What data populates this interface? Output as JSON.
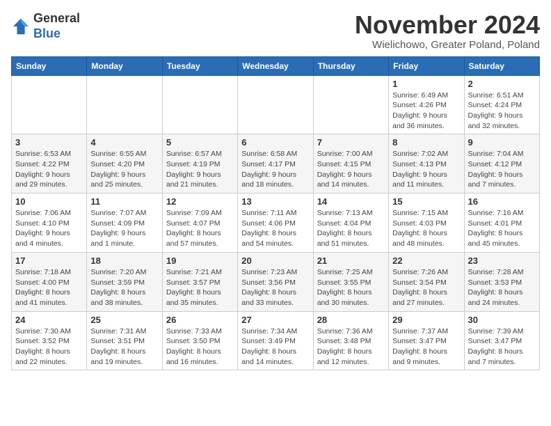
{
  "logo": {
    "general": "General",
    "blue": "Blue"
  },
  "title": "November 2024",
  "location": "Wielichowo, Greater Poland, Poland",
  "weekdays": [
    "Sunday",
    "Monday",
    "Tuesday",
    "Wednesday",
    "Thursday",
    "Friday",
    "Saturday"
  ],
  "weeks": [
    [
      {
        "day": "",
        "info": ""
      },
      {
        "day": "",
        "info": ""
      },
      {
        "day": "",
        "info": ""
      },
      {
        "day": "",
        "info": ""
      },
      {
        "day": "",
        "info": ""
      },
      {
        "day": "1",
        "info": "Sunrise: 6:49 AM\nSunset: 4:26 PM\nDaylight: 9 hours and 36 minutes."
      },
      {
        "day": "2",
        "info": "Sunrise: 6:51 AM\nSunset: 4:24 PM\nDaylight: 9 hours and 32 minutes."
      }
    ],
    [
      {
        "day": "3",
        "info": "Sunrise: 6:53 AM\nSunset: 4:22 PM\nDaylight: 9 hours and 29 minutes."
      },
      {
        "day": "4",
        "info": "Sunrise: 6:55 AM\nSunset: 4:20 PM\nDaylight: 9 hours and 25 minutes."
      },
      {
        "day": "5",
        "info": "Sunrise: 6:57 AM\nSunset: 4:19 PM\nDaylight: 9 hours and 21 minutes."
      },
      {
        "day": "6",
        "info": "Sunrise: 6:58 AM\nSunset: 4:17 PM\nDaylight: 9 hours and 18 minutes."
      },
      {
        "day": "7",
        "info": "Sunrise: 7:00 AM\nSunset: 4:15 PM\nDaylight: 9 hours and 14 minutes."
      },
      {
        "day": "8",
        "info": "Sunrise: 7:02 AM\nSunset: 4:13 PM\nDaylight: 9 hours and 11 minutes."
      },
      {
        "day": "9",
        "info": "Sunrise: 7:04 AM\nSunset: 4:12 PM\nDaylight: 9 hours and 7 minutes."
      }
    ],
    [
      {
        "day": "10",
        "info": "Sunrise: 7:06 AM\nSunset: 4:10 PM\nDaylight: 9 hours and 4 minutes."
      },
      {
        "day": "11",
        "info": "Sunrise: 7:07 AM\nSunset: 4:09 PM\nDaylight: 9 hours and 1 minute."
      },
      {
        "day": "12",
        "info": "Sunrise: 7:09 AM\nSunset: 4:07 PM\nDaylight: 8 hours and 57 minutes."
      },
      {
        "day": "13",
        "info": "Sunrise: 7:11 AM\nSunset: 4:06 PM\nDaylight: 8 hours and 54 minutes."
      },
      {
        "day": "14",
        "info": "Sunrise: 7:13 AM\nSunset: 4:04 PM\nDaylight: 8 hours and 51 minutes."
      },
      {
        "day": "15",
        "info": "Sunrise: 7:15 AM\nSunset: 4:03 PM\nDaylight: 8 hours and 48 minutes."
      },
      {
        "day": "16",
        "info": "Sunrise: 7:16 AM\nSunset: 4:01 PM\nDaylight: 8 hours and 45 minutes."
      }
    ],
    [
      {
        "day": "17",
        "info": "Sunrise: 7:18 AM\nSunset: 4:00 PM\nDaylight: 8 hours and 41 minutes."
      },
      {
        "day": "18",
        "info": "Sunrise: 7:20 AM\nSunset: 3:59 PM\nDaylight: 8 hours and 38 minutes."
      },
      {
        "day": "19",
        "info": "Sunrise: 7:21 AM\nSunset: 3:57 PM\nDaylight: 8 hours and 35 minutes."
      },
      {
        "day": "20",
        "info": "Sunrise: 7:23 AM\nSunset: 3:56 PM\nDaylight: 8 hours and 33 minutes."
      },
      {
        "day": "21",
        "info": "Sunrise: 7:25 AM\nSunset: 3:55 PM\nDaylight: 8 hours and 30 minutes."
      },
      {
        "day": "22",
        "info": "Sunrise: 7:26 AM\nSunset: 3:54 PM\nDaylight: 8 hours and 27 minutes."
      },
      {
        "day": "23",
        "info": "Sunrise: 7:28 AM\nSunset: 3:53 PM\nDaylight: 8 hours and 24 minutes."
      }
    ],
    [
      {
        "day": "24",
        "info": "Sunrise: 7:30 AM\nSunset: 3:52 PM\nDaylight: 8 hours and 22 minutes."
      },
      {
        "day": "25",
        "info": "Sunrise: 7:31 AM\nSunset: 3:51 PM\nDaylight: 8 hours and 19 minutes."
      },
      {
        "day": "26",
        "info": "Sunrise: 7:33 AM\nSunset: 3:50 PM\nDaylight: 8 hours and 16 minutes."
      },
      {
        "day": "27",
        "info": "Sunrise: 7:34 AM\nSunset: 3:49 PM\nDaylight: 8 hours and 14 minutes."
      },
      {
        "day": "28",
        "info": "Sunrise: 7:36 AM\nSunset: 3:48 PM\nDaylight: 8 hours and 12 minutes."
      },
      {
        "day": "29",
        "info": "Sunrise: 7:37 AM\nSunset: 3:47 PM\nDaylight: 8 hours and 9 minutes."
      },
      {
        "day": "30",
        "info": "Sunrise: 7:39 AM\nSunset: 3:47 PM\nDaylight: 8 hours and 7 minutes."
      }
    ]
  ]
}
